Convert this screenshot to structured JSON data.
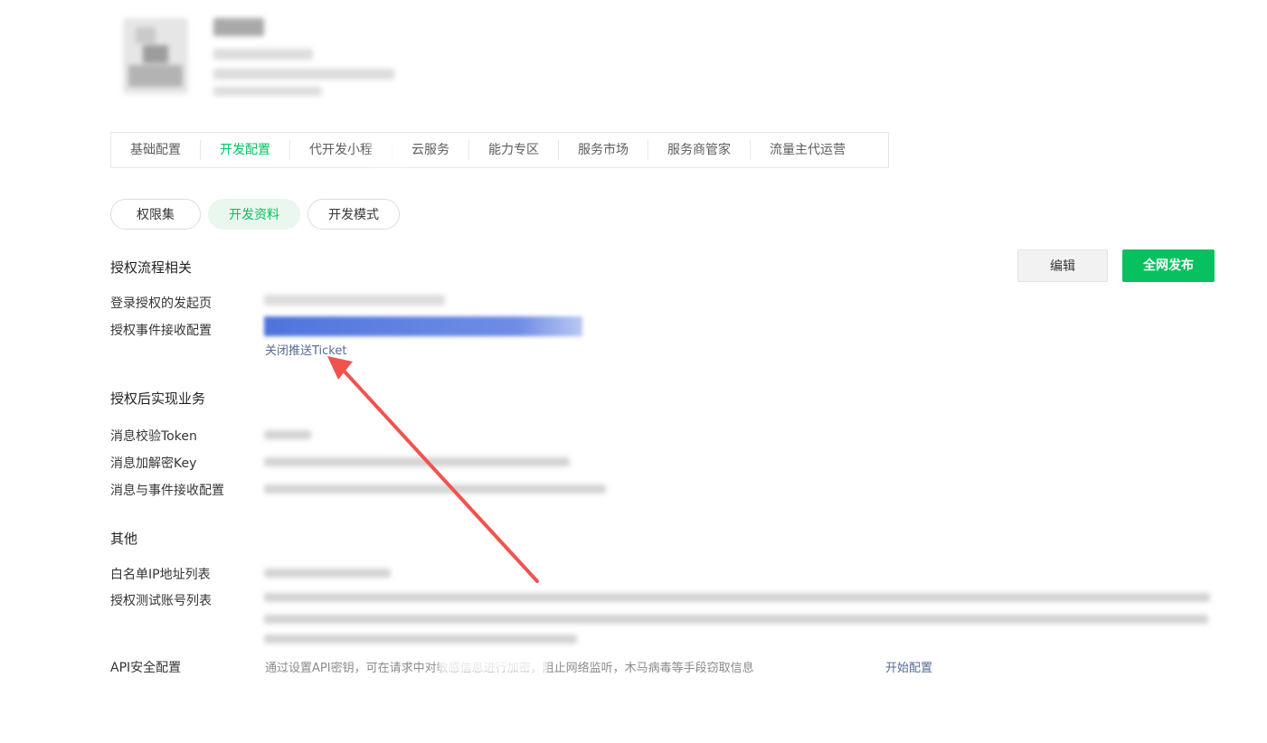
{
  "main_tabs": [
    {
      "label": "基础配置",
      "active": false
    },
    {
      "label": "开发配置",
      "active": true
    },
    {
      "label": "代开发小程",
      "active": false
    },
    {
      "label": "云服务",
      "active": false
    },
    {
      "label": "能力专区",
      "active": false
    },
    {
      "label": "服务市场",
      "active": false
    },
    {
      "label": "服务商管家",
      "active": false
    },
    {
      "label": "流量主代运营",
      "active": false
    }
  ],
  "sub_tabs": [
    {
      "label": "权限集",
      "active": false
    },
    {
      "label": "开发资料",
      "active": true
    },
    {
      "label": "开发模式",
      "active": false
    }
  ],
  "actions": {
    "edit": "编辑",
    "publish": "全网发布"
  },
  "sections": {
    "auth_flow": {
      "title": "授权流程相关",
      "login_page_label": "登录授权的发起页",
      "event_config_label": "授权事件接收配置",
      "ticket_link": "关闭推送Ticket"
    },
    "after_auth": {
      "title": "授权后实现业务",
      "token_label": "消息校验Token",
      "aes_key_label": "消息加解密Key",
      "msg_event_label": "消息与事件接收配置"
    },
    "other": {
      "title": "其他",
      "ip_whitelist_label": "白名单IP地址列表",
      "test_accounts_label": "授权测试账号列表",
      "api_security_label": "API安全配置",
      "api_security_desc": "通过设置API密钥，可在请求中对敏感信息进行加密，阻止网络监听，木马病毒等手段窃取信息",
      "api_security_link": "开始配置"
    }
  },
  "colors": {
    "accent": "#07c160",
    "link": "#576b95",
    "annotation_arrow": "#f0534e"
  }
}
